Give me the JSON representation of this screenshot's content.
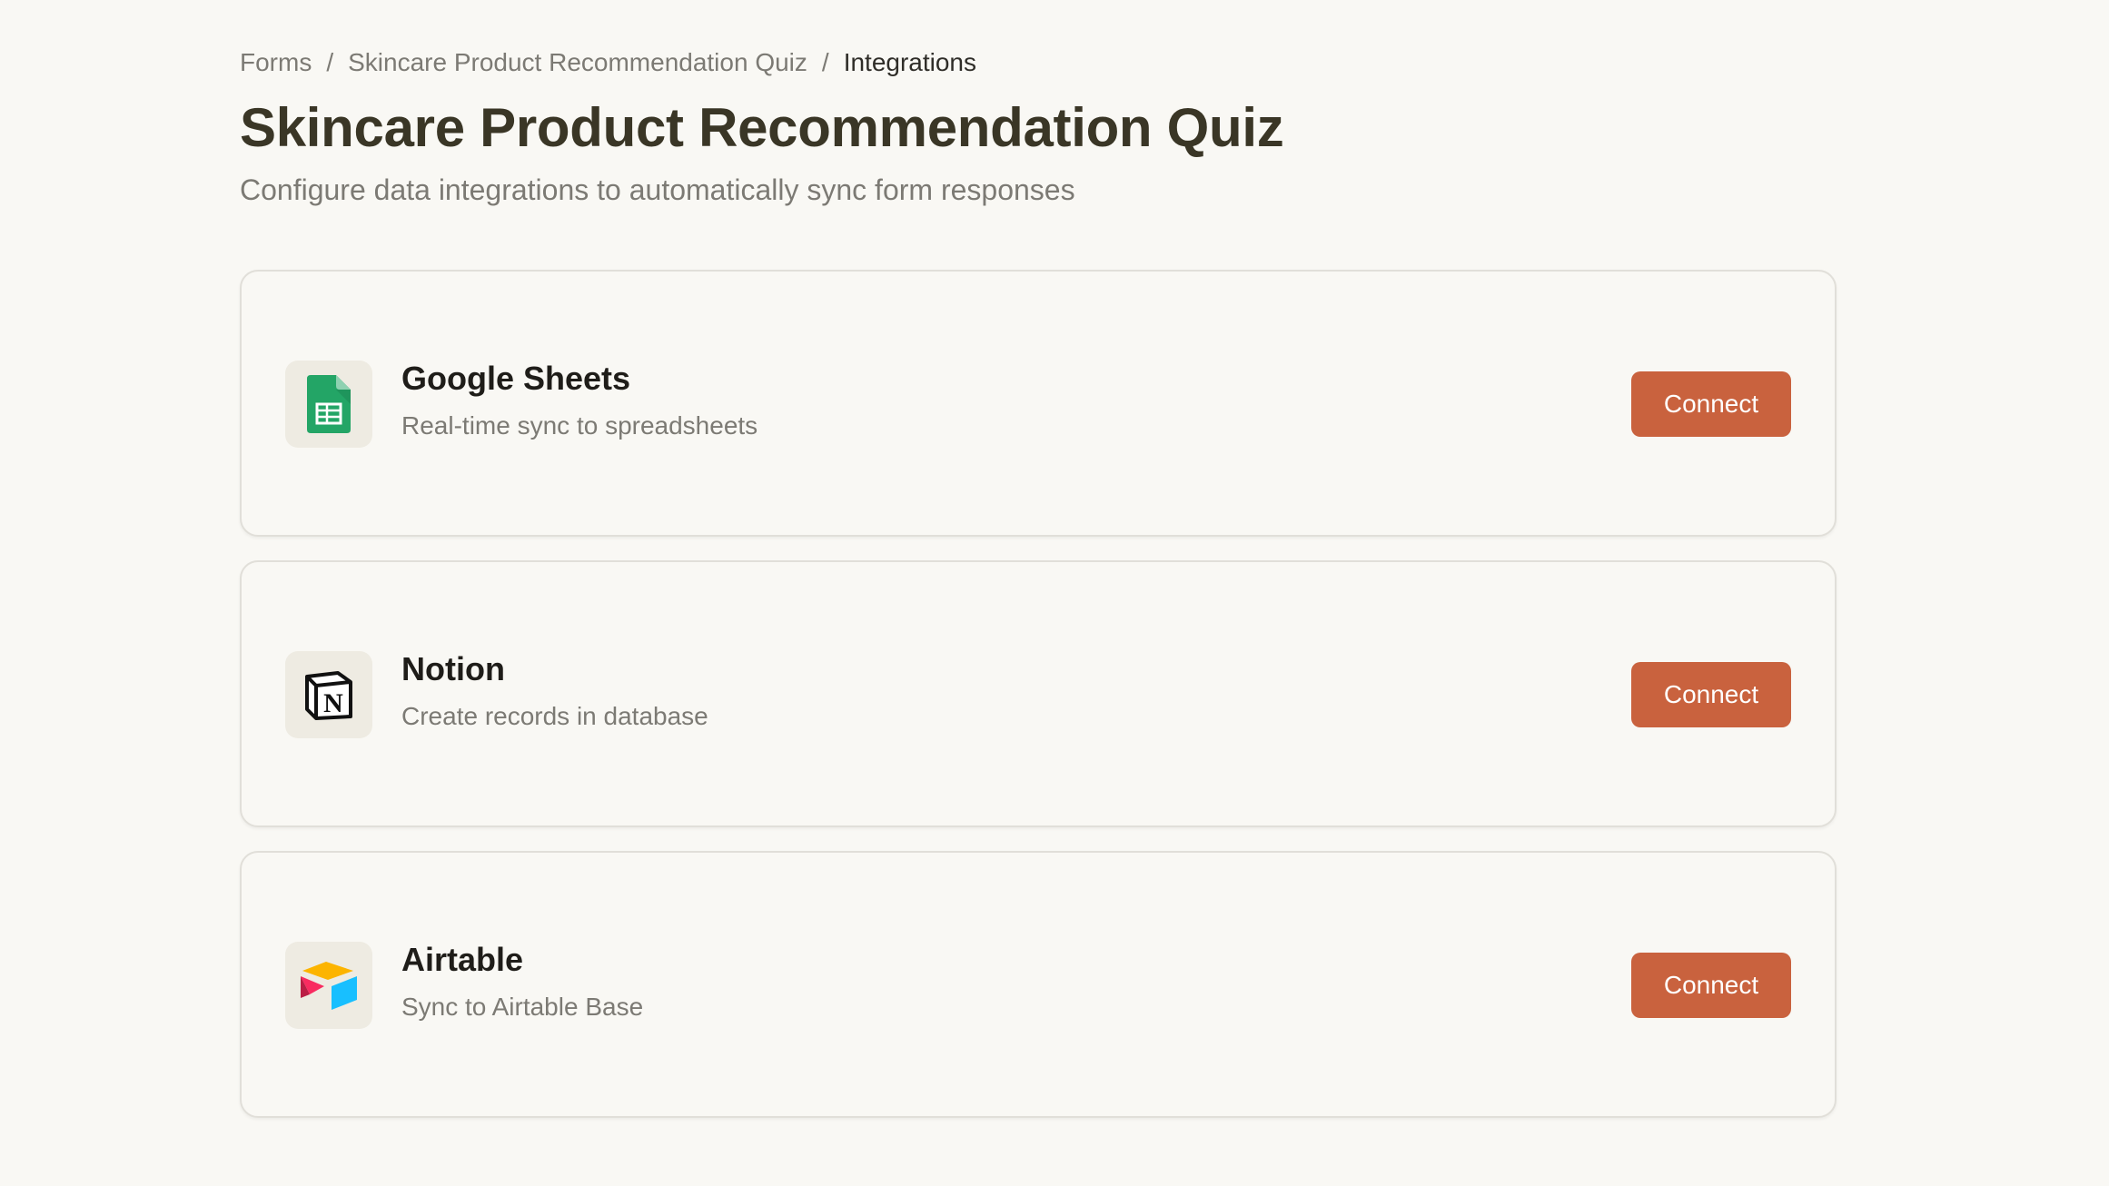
{
  "breadcrumb": {
    "items": [
      "Forms",
      "Skincare Product Recommendation Quiz"
    ],
    "separator": "/",
    "current": "Integrations"
  },
  "header": {
    "title": "Skincare Product Recommendation Quiz",
    "subtitle": "Configure data integrations to automatically sync form responses"
  },
  "integrations": [
    {
      "name": "Google Sheets",
      "description": "Real-time sync to spreadsheets",
      "button_label": "Connect",
      "icon": "google-sheets-icon"
    },
    {
      "name": "Notion",
      "description": "Create records in database",
      "button_label": "Connect",
      "icon": "notion-icon"
    },
    {
      "name": "Airtable",
      "description": "Sync to Airtable Base",
      "button_label": "Connect",
      "icon": "airtable-icon"
    }
  ],
  "colors": {
    "background": "#f9f8f4",
    "accent": "#c9623e",
    "title": "#3a3626",
    "muted_text": "#7c7a74",
    "card_border": "#e1dfd9",
    "icon_background": "#eeebe2"
  }
}
